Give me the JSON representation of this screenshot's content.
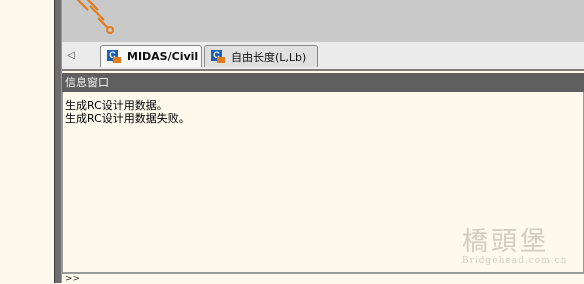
{
  "tabs": [
    {
      "label": "MIDAS/Civil",
      "icon": "midas-civil-icon",
      "active": true
    },
    {
      "label": "自由长度(L,Lb)",
      "icon": "midas-civil-icon",
      "active": false
    }
  ],
  "tab_scroll": "◁",
  "info_window": {
    "title": "信息窗口",
    "messages": [
      "生成RC设计用数据。",
      "生成RC设计用数据失败。"
    ]
  },
  "command_prompt": ">>",
  "watermark": {
    "logo_text": "橋頭堡",
    "url": "Bridgehead.com.cn"
  },
  "colors": {
    "header_bg": "#5f5f5f",
    "info_bg": "#fdf9ec",
    "canvas_bg": "#c9c9c9"
  }
}
